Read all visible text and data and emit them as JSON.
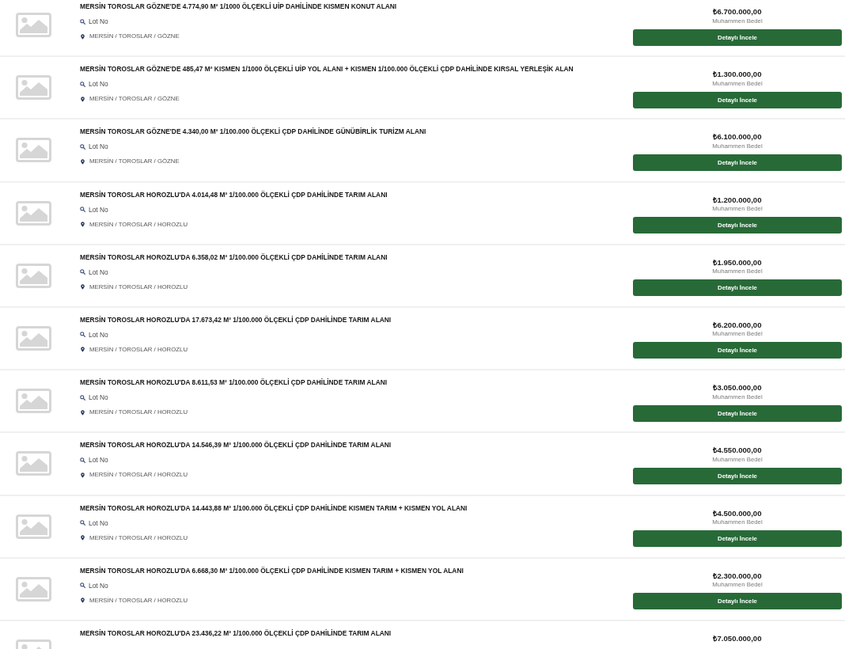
{
  "listings": [
    {
      "title": "MERSİN TOROSLAR GÖZNE'DE 4.774,90 M² 1/1000 ÖLÇEKLİ UİP DAHİLİNDE KISMEN KONUT ALANI",
      "lot": "Lot No",
      "location": "MERSİN / TOROSLAR / GÖZNE",
      "price": "₺6.700.000,00",
      "price_label": "Muhammen Bedel",
      "button": "Detaylı İncele"
    },
    {
      "title": "MERSİN TOROSLAR GÖZNE'DE 485,47 M² KISMEN 1/1000 ÖLÇEKLİ UİP YOL ALANI + KISMEN 1/100.000 ÖLÇEKLİ ÇDP DAHİLİNDE KIRSAL YERLEŞİK ALAN",
      "lot": "Lot No",
      "location": "MERSİN / TOROSLAR / GÖZNE",
      "price": "₺1.300.000,00",
      "price_label": "Muhammen Bedel",
      "button": "Detaylı İncele"
    },
    {
      "title": "MERSİN TOROSLAR GÖZNE'DE 4.340,00 M² 1/100.000 ÖLÇEKLİ ÇDP DAHİLİNDE GÜNÜBİRLİK TURİZM ALANI",
      "lot": "Lot No",
      "location": "MERSİN / TOROSLAR / GÖZNE",
      "price": "₺6.100.000,00",
      "price_label": "Muhammen Bedel",
      "button": "Detaylı İncele"
    },
    {
      "title": "MERSİN TOROSLAR HOROZLU'DA 4.014,48 M² 1/100.000 ÖLÇEKLİ ÇDP DAHİLİNDE TARIM ALANI",
      "lot": "Lot No",
      "location": "MERSİN / TOROSLAR / HOROZLU",
      "price": "₺1.200.000,00",
      "price_label": "Muhammen Bedel",
      "button": "Detaylı İncele"
    },
    {
      "title": "MERSİN TOROSLAR HOROZLU'DA 6.358,02 M² 1/100.000 ÖLÇEKLİ ÇDP DAHİLİNDE TARIM ALANI",
      "lot": "Lot No",
      "location": "MERSİN / TOROSLAR / HOROZLU",
      "price": "₺1.950.000,00",
      "price_label": "Muhammen Bedel",
      "button": "Detaylı İncele"
    },
    {
      "title": "MERSİN TOROSLAR HOROZLU'DA 17.673,42 M² 1/100.000 ÖLÇEKLİ ÇDP DAHİLİNDE TARIM ALANI",
      "lot": "Lot No",
      "location": "MERSİN / TOROSLAR / HOROZLU",
      "price": "₺6.200.000,00",
      "price_label": "Muhammen Bedel",
      "button": "Detaylı İncele"
    },
    {
      "title": "MERSİN TOROSLAR HOROZLU'DA 8.611,53 M² 1/100.000 ÖLÇEKLİ ÇDP DAHİLİNDE TARIM ALANI",
      "lot": "Lot No",
      "location": "MERSİN / TOROSLAR / HOROZLU",
      "price": "₺3.050.000,00",
      "price_label": "Muhammen Bedel",
      "button": "Detaylı İncele"
    },
    {
      "title": "MERSİN TOROSLAR HOROZLU'DA 14.546,39 M² 1/100.000 ÖLÇEKLİ ÇDP DAHİLİNDE TARIM ALANI",
      "lot": "Lot No",
      "location": "MERSİN / TOROSLAR / HOROZLU",
      "price": "₺4.550.000,00",
      "price_label": "Muhammen Bedel",
      "button": "Detaylı İncele"
    },
    {
      "title": "MERSİN TOROSLAR HOROZLU'DA 14.443,88 M² 1/100.000 ÖLÇEKLİ ÇDP DAHİLİNDE KISMEN TARIM + KISMEN YOL ALANI",
      "lot": "Lot No",
      "location": "MERSİN / TOROSLAR / HOROZLU",
      "price": "₺4.500.000,00",
      "price_label": "Muhammen Bedel",
      "button": "Detaylı İncele"
    },
    {
      "title": "MERSİN TOROSLAR HOROZLU'DA 6.668,30 M² 1/100.000 ÖLÇEKLİ ÇDP DAHİLİNDE KISMEN TARIM + KISMEN YOL ALANI",
      "lot": "Lot No",
      "location": "MERSİN / TOROSLAR / HOROZLU",
      "price": "₺2.300.000,00",
      "price_label": "Muhammen Bedel",
      "button": "Detaylı İncele"
    },
    {
      "title": "MERSİN TOROSLAR HOROZLU'DA 23.436,22 M² 1/100.000 ÖLÇEKLİ ÇDP DAHİLİNDE TARIM ALANI",
      "price": "₺7.050.000,00"
    }
  ]
}
